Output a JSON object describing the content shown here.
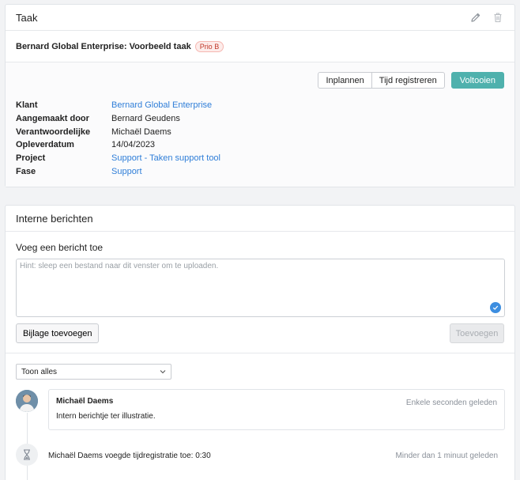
{
  "task_card": {
    "title": "Taak",
    "edit_icon": "pencil-icon",
    "delete_icon": "trash-icon",
    "subject": "Bernard Global Enterprise: Voorbeeld taak",
    "priority_badge": "Prio B",
    "actions": {
      "plan": "Inplannen",
      "register_time": "Tijd registreren",
      "complete": "Voltooien"
    },
    "properties": [
      {
        "key": "Klant",
        "value": "Bernard Global Enterprise",
        "link": true
      },
      {
        "key": "Aangemaakt door",
        "value": "Bernard Geudens",
        "link": false
      },
      {
        "key": "Verantwoordelijke",
        "value": "Michaël Daems",
        "link": false
      },
      {
        "key": "Opleverdatum",
        "value": "14/04/2023",
        "link": false
      },
      {
        "key": "Project",
        "value": "Support - Taken support tool",
        "link": true
      },
      {
        "key": "Fase",
        "value": "Support",
        "link": true
      }
    ]
  },
  "messages_card": {
    "title": "Interne berichten",
    "compose_heading": "Voeg een bericht toe",
    "textarea_placeholder": "Hint: sleep een bestand naar dit venster om te uploaden.",
    "attach_button": "Bijlage toevoegen",
    "add_button": "Toevoegen",
    "filter_selected": "Toon alles",
    "message": {
      "author": "Michaël Daems",
      "time": "Enkele seconden geleden",
      "text": "Intern berichtje ter illustratie."
    },
    "event": {
      "text": "Michaël Daems voegde tijdregistratie toe: 0:30",
      "time": "Minder dan 1 minuut geleden"
    }
  },
  "colors": {
    "accent": "#4fb1ad",
    "link": "#2f7ed8",
    "badge": "#c0392b"
  }
}
